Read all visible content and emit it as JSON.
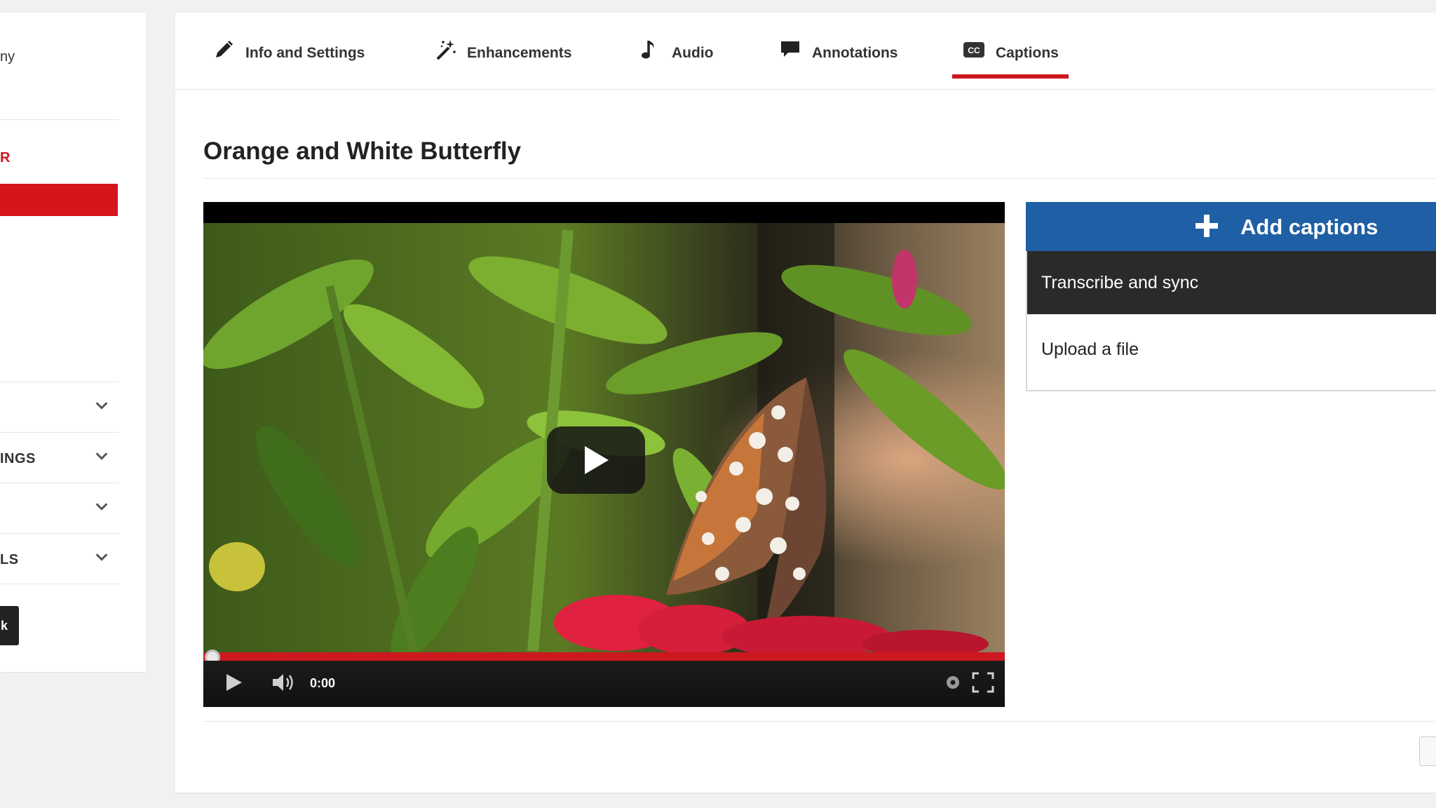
{
  "sidebar": {
    "top_text": "ny",
    "red_label": "R",
    "rows": [
      {
        "label": ""
      },
      {
        "label": "INGS"
      },
      {
        "label": ""
      },
      {
        "label": "LS"
      }
    ],
    "black_button_label": "k"
  },
  "tabs": [
    {
      "label": "Info and Settings",
      "icon": "pencil-icon"
    },
    {
      "label": "Enhancements",
      "icon": "magic-wand-icon"
    },
    {
      "label": "Audio",
      "icon": "music-note-icon"
    },
    {
      "label": "Annotations",
      "icon": "speech-bubble-icon"
    },
    {
      "label": "Captions",
      "icon": "cc-icon",
      "active": true
    }
  ],
  "page_title": "Orange and White Butterfly",
  "player": {
    "time": "0:00",
    "progress_fraction": 0.0
  },
  "captions_panel": {
    "add_label": "Add captions",
    "options": [
      "Transcribe and sync",
      "Upload a file"
    ]
  },
  "colors": {
    "accent_red": "#cc181e",
    "button_blue": "#1f5fa5",
    "dark_option": "#2a2a2a"
  }
}
